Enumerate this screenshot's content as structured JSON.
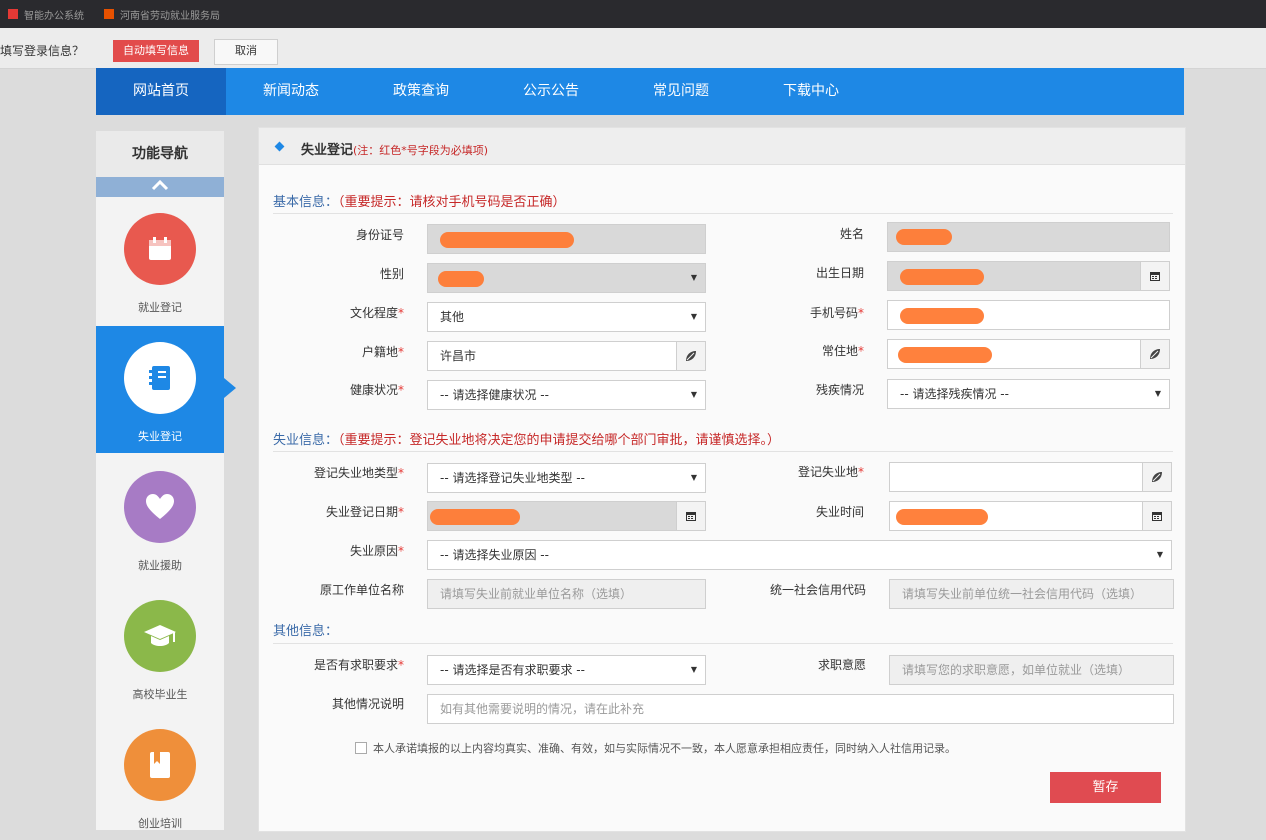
{
  "browser": {
    "tabs": [
      {
        "label": "智能办公系统"
      },
      {
        "label": "河南省劳动就业服务局"
      }
    ]
  },
  "notification": {
    "question": "填写登录信息？",
    "autofill_label": "自动填写信息",
    "cancel_label": "取消"
  },
  "nav": {
    "items": [
      {
        "label": "网站首页"
      },
      {
        "label": "新闻动态"
      },
      {
        "label": "政策查询"
      },
      {
        "label": "公示公告"
      },
      {
        "label": "常见问题"
      },
      {
        "label": "下载中心"
      }
    ]
  },
  "sidebar": {
    "title": "功能导航",
    "items": [
      {
        "label": "就业登记",
        "icon": "calendar-icon",
        "color": "#e8594f"
      },
      {
        "label": "失业登记",
        "icon": "notebook-icon",
        "color": "#1e88e5"
      },
      {
        "label": "就业援助",
        "icon": "heart-icon",
        "color": "#a77bc5"
      },
      {
        "label": "高校毕业生",
        "icon": "graduation-cap-icon",
        "color": "#8bb84a"
      },
      {
        "label": "创业培训",
        "icon": "book-icon",
        "color": "#ef8f3a"
      }
    ]
  },
  "form": {
    "title": "失业登记",
    "title_note": "(注：红色*号字段为必填项)",
    "sections": {
      "basic": {
        "label": "基本信息：",
        "tip": "（重要提示：请核对手机号码是否正确）"
      },
      "unemp": {
        "label": "失业信息：",
        "tip": "（重要提示：登记失业地将决定您的申请提交给哪个部门审批，请谨慎选择。）"
      },
      "other": {
        "label": "其他信息："
      }
    },
    "labels": {
      "id": "身份证号",
      "name": "姓名",
      "gender": "性别",
      "birth": "出生日期",
      "education": "文化程度",
      "phone": "手机号码",
      "hukou": "户籍地",
      "residence": "常住地",
      "health": "健康状况",
      "disability": "残疾情况",
      "unemp_place_type": "登记失业地类型",
      "unemp_place": "登记失业地",
      "unemp_date": "失业登记日期",
      "unemp_time": "失业时间",
      "unemp_reason": "失业原因",
      "former_employer": "原工作单位名称",
      "credit_code": "统一社会信用代码",
      "job_seeking": "是否有求职要求",
      "job_intent": "求职意愿",
      "other_notes": "其他情况说明"
    },
    "required_mark": "*",
    "values": {
      "education": "其他",
      "hukou": "许昌市"
    },
    "selects": {
      "health": "-- 请选择健康状况 --",
      "disability": "-- 请选择残疾情况 --",
      "unemp_place_type": "-- 请选择登记失业地类型 --",
      "unemp_reason": "-- 请选择失业原因 --",
      "job_seeking": "-- 请选择是否有求职要求 --"
    },
    "placeholders": {
      "former_employer": "请填写失业前就业单位名称（选填）",
      "credit_code": "请填写失业前单位统一社会信用代码（选填）",
      "job_intent": "请填写您的求职意愿，如单位就业（选填）",
      "other_notes": "如有其他需要说明的情况，请在此补充"
    },
    "agreement": "本人承诺填报的以上内容均真实、准确、有效，如与实际情况不一致，本人愿意承担相应责任，同时纳入人社信用记录。",
    "save_label": "暂存"
  }
}
